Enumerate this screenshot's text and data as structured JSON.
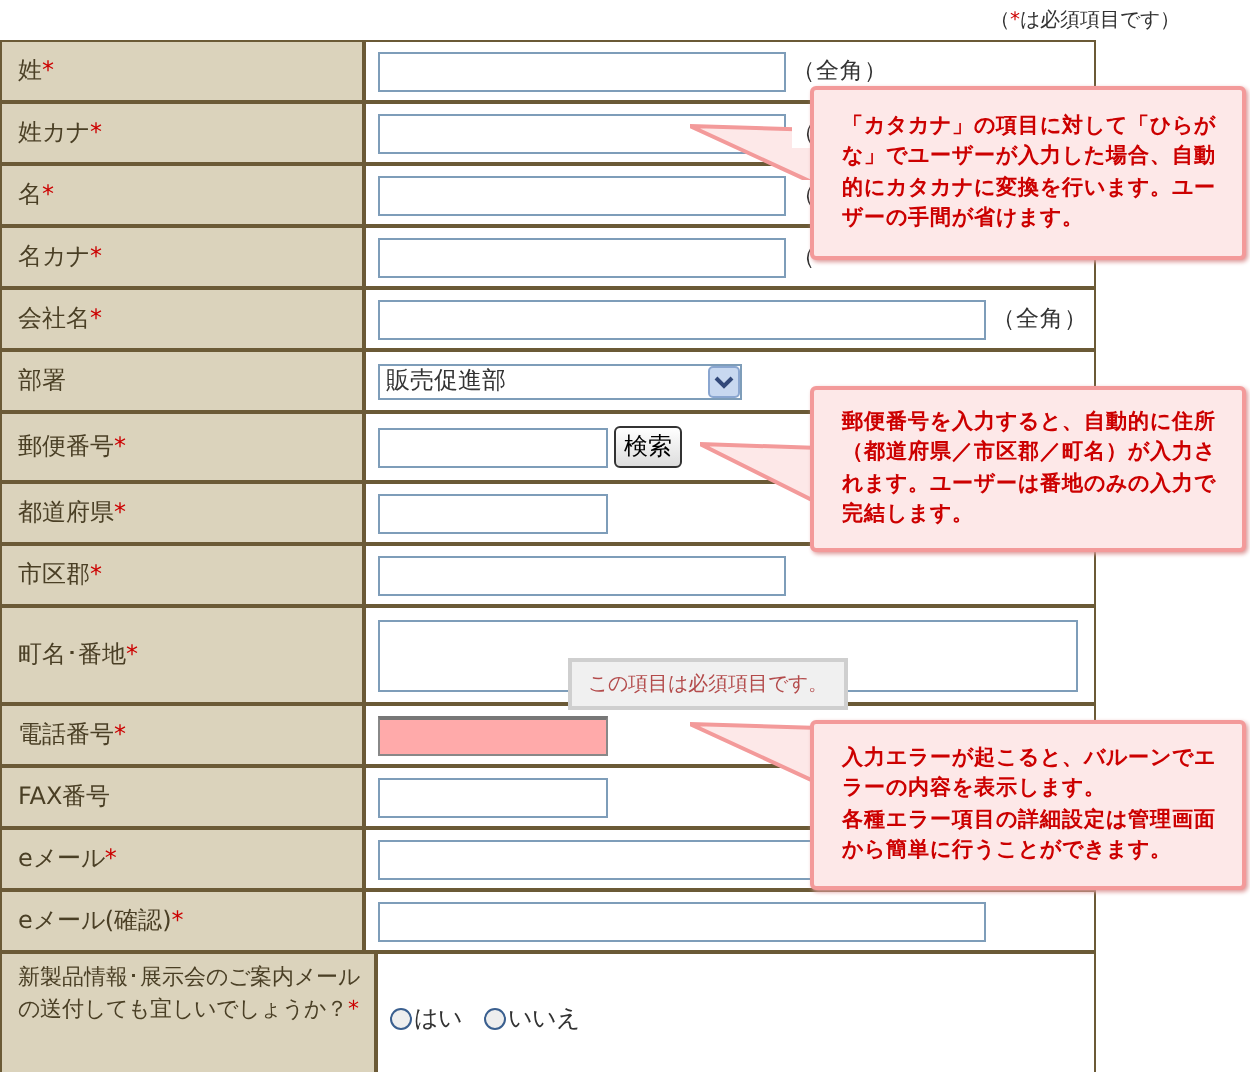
{
  "required_note": {
    "mark": "*",
    "text": "は必須項目です）",
    "open": "（"
  },
  "rows": [
    {
      "label": "姓",
      "required": true,
      "kind": "medium",
      "note": "（全角）",
      "error": false
    },
    {
      "label": "姓カナ",
      "required": true,
      "kind": "medium",
      "note": "（",
      "error": false
    },
    {
      "label": "名",
      "required": true,
      "kind": "medium",
      "note": "（",
      "error": false
    },
    {
      "label": "名カナ",
      "required": true,
      "kind": "medium",
      "note": "（",
      "error": false
    },
    {
      "label": "会社名",
      "required": true,
      "kind": "long",
      "note": "（全角）",
      "error": false
    },
    {
      "label": "部署",
      "required": false,
      "kind": "select",
      "value": "販売促進部"
    },
    {
      "label": "郵便番号",
      "required": true,
      "kind": "zip",
      "button": "検索",
      "error": false
    },
    {
      "label": "都道府県",
      "required": true,
      "kind": "short",
      "error": false
    },
    {
      "label": "市区郡",
      "required": true,
      "kind": "medium",
      "error": false
    },
    {
      "label": "町名･番地",
      "required": true,
      "kind": "textarea",
      "error": false
    },
    {
      "label": "電話番号",
      "required": true,
      "kind": "short",
      "error": true
    },
    {
      "label": "FAX番号",
      "required": false,
      "kind": "short",
      "error": false
    },
    {
      "label": "eメール",
      "required": true,
      "kind": "long",
      "error": false
    },
    {
      "label": "eメール(確認)",
      "required": true,
      "kind": "long",
      "error": false
    },
    {
      "label": "新製品情報･展示会のご案内メールの送付しても宜しいでしょうか？",
      "required": true,
      "kind": "radio",
      "options": [
        {
          "label": "はい",
          "selected": false
        },
        {
          "label": "いいえ",
          "selected": false
        }
      ]
    }
  ],
  "error_tooltip": "この項目は必須項目です。",
  "callouts": [
    {
      "paragraphs": [
        "「カタカナ」の項目に対して「ひらがな」でユーザーが入力した場合、自動的にカタカナに変換を行います。ユーザーの手間が省けます。"
      ]
    },
    {
      "paragraphs": [
        "郵便番号を入力すると、自動的に住所（都道府県／市区郡／町名）が入力されます。ユーザーは番地のみの入力で完結します。"
      ]
    },
    {
      "paragraphs": [
        "入力エラーが起こると、バルーンでエラーの内容を表示します。",
        "各種エラー項目の詳細設定は管理画面から簡単に行うことができます。"
      ]
    }
  ]
}
